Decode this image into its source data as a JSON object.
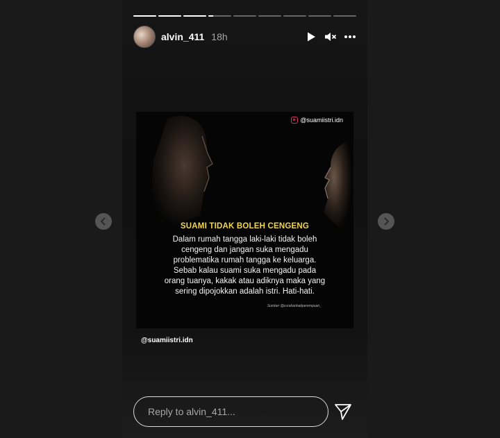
{
  "story": {
    "progress_segments": [
      1,
      1,
      1,
      0.2,
      0,
      0,
      0,
      0,
      0
    ],
    "user": {
      "username": "alvin_411",
      "time": "18h"
    },
    "controls": {
      "play_icon": "play-icon",
      "mute_icon": "muted-speaker-icon",
      "more_icon": "more-horizontal-icon"
    },
    "post": {
      "ig_handle": "@suamiistri.idn",
      "title": "SUAMI TIDAK BOLEH CENGENG",
      "body": "Dalam rumah tangga laki-laki tidak boleh cengeng dan jangan suka mengadu problematika rumah tangga ke keluarga. Sebab kalau suami suka mengadu pada orang tuanya, kakak atau adiknya maka yang sering dipojokkan adalah istri. Hati-hati.",
      "source": "Sumber @curahanhatiperempuan_",
      "title_color": "#f2d64b"
    },
    "mention": "@suamiistri.idn",
    "reply": {
      "placeholder": "Reply to alvin_411..."
    }
  },
  "navigation": {
    "prev_icon": "chevron-left-icon",
    "next_icon": "chevron-right-icon"
  }
}
